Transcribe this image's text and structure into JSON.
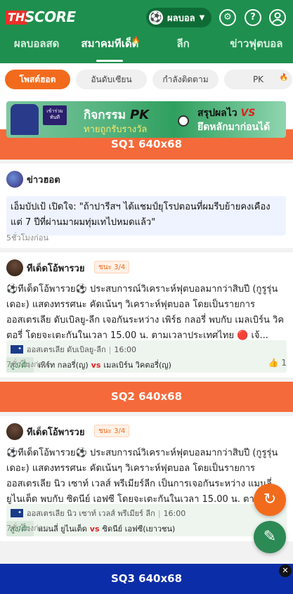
{
  "header": {
    "logo_th": "TH",
    "logo_score": "SCORE",
    "sport_label": "ผลบอล",
    "sport_icon": "soccer-ball-icon"
  },
  "nav": {
    "tabs": [
      {
        "label": "ผลบอลสด",
        "active": false
      },
      {
        "label": "สมาคมทีเด็ด",
        "active": true,
        "hot": true
      },
      {
        "label": "ลีก",
        "active": false
      },
      {
        "label": "ข่าวฟุตบอล",
        "active": false
      }
    ]
  },
  "chips": [
    {
      "label": "โพสต์ฮอต",
      "active": true
    },
    {
      "label": "อันดับเซียน",
      "active": false
    },
    {
      "label": "กำลังติดตาม",
      "active": false
    },
    {
      "label": "PK",
      "active": false,
      "hot": true
    }
  ],
  "banner": {
    "join": "เข้าร่วมทันที",
    "line1_a": "กิจกรรม",
    "line1_b": "PK",
    "line2": "ทายถูกรับรางวัล",
    "line3_a": "สรุปผลไว",
    "line3_b": "VS",
    "line4": "ยึดหลักมาก่อนได้ก่อน"
  },
  "ads": {
    "sq1": "SQ1 640x68",
    "sq2": "SQ2 640x68",
    "sq3": "SQ3 640x68"
  },
  "news_card": {
    "author": "ข่าวฮอต",
    "quote": "เอ็มบัปเป้ เปิดใจ: \"ถ้าปารีสฯ ได้แชมป์ยุโรปตอนที่ผมรีบย้ายคงเคือง แต่ 7 ปีที่ผ่านมาผมทุ่มเทไปหมดแล้ว\"",
    "time": "5ชั่วโมงก่อน"
  },
  "tip_cards": [
    {
      "author": "ทีเด็ดโอ้พารวย",
      "badge": "ชนะ 3/4",
      "body": "⚽ทีเด็ดโอ้พารวย⚽ ประสบการณ์วิเคราะห์ฟุตบอลมากว่าสิบปี (กูรูรุ่นเดอะ) แสดงทรรศนะ คัดเน้นๆ วิเคราะห์ฟุตบอล โดยเป็นรายการออสเตรเลีย ดับเบิลยู-ลีก เจอกันระหว่าง เพิร์ธ กลอรี่ พบกับ เมลเบิร์น วิคตอรี่ โดยจะเตะกันในเวลา 15.00 น. ตามเวลาประเทศไทย 🔴 เจ้...",
      "league": "ออสเตรเลีย ดับเบิลยู-ลีก",
      "kickoff": "16:00",
      "market": "สูง/ต่ำ",
      "home": "เพิร์ท กลอรี่(ญ)",
      "vs": "vs",
      "away": "เมลเบิร์น วิคตอรี่(ญ)",
      "time": "7ชั่วโมงก่อน",
      "likes": "1"
    },
    {
      "author": "ทีเด็ดโอ้พารวย",
      "badge": "ชนะ 3/4",
      "body": "⚽ทีเด็ดโอ้พารวย⚽ ประสบการณ์วิเคราะห์ฟุตบอลมากว่าสิบปี (กูรูรุ่นเดอะ) แสดงทรรศนะ คัดเน้นๆ วิเคราะห์ฟุตบอล โดยเป็นรายการออสเตรเลีย นิว เซาท์ เวลส์ พรีเมียร์ลีก เป็นการเจอกันระหว่าง แมนลี่ ยูไนเต็ด พบกับ ซิดนีย์ เอฟซี โดยจะเตะกันในเวลา 15.00 น. ตาม...",
      "league": "ออสเตรเลีย นิว เซาท์ เวลส์ พรีเมียร์ ลีก",
      "kickoff": "16:00",
      "market": "สูง/ต่ำ",
      "home": "แมนลี่ ยูไนเต็ด",
      "vs": "vs",
      "away": "ซิดนีย์ เอฟซี(เยาวชน)",
      "time": "7ชั่วโมงก่อน"
    }
  ],
  "colors": {
    "brand_green": "#1e8f4e",
    "accent_orange": "#f26b1d",
    "ad_blue": "#0b2ea8",
    "vs_red": "#e02020"
  }
}
